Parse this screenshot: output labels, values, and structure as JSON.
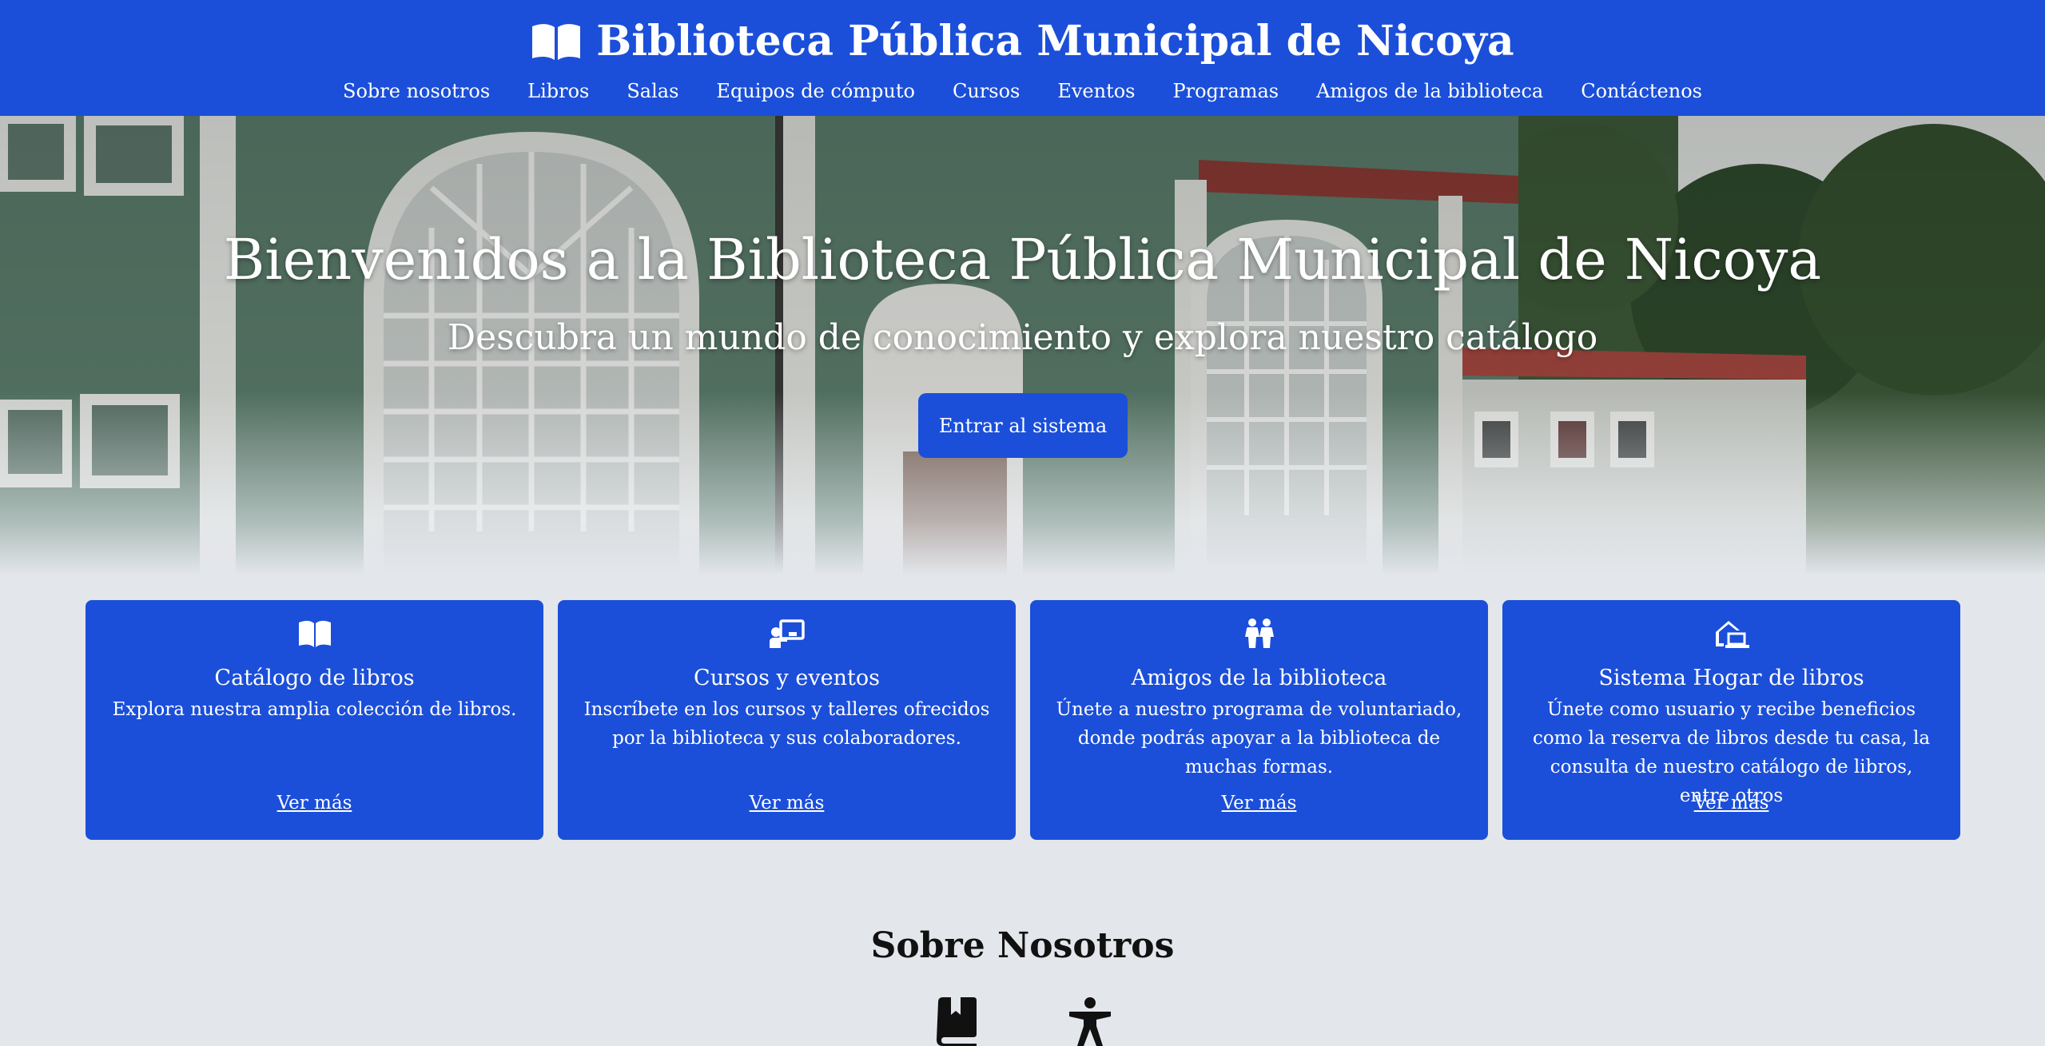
{
  "header": {
    "title": "Biblioteca Pública Municipal de Nicoya",
    "brand_icon": "open-book-icon",
    "nav": [
      "Sobre nosotros",
      "Libros",
      "Salas",
      "Equipos de cómputo",
      "Cursos",
      "Eventos",
      "Programas",
      "Amigos de la biblioteca",
      "Contáctenos"
    ]
  },
  "hero": {
    "title": "Bienvenidos a la Biblioteca Pública Municipal de Nicoya",
    "subtitle": "Descubra un mundo de conocimiento y explora nuestro catálogo",
    "button": "Entrar al sistema"
  },
  "cards": [
    {
      "icon": "open-book-icon",
      "title": "Catálogo de libros",
      "description": "Explora nuestra amplia colección de libros.",
      "link": "Ver más"
    },
    {
      "icon": "presentation-icon",
      "title": "Cursos y eventos",
      "description": "Inscríbete en los cursos y talleres ofrecidos por la biblioteca y sus colaboradores.",
      "link": "Ver más"
    },
    {
      "icon": "people-icon",
      "title": "Amigos de la biblioteca",
      "description": "Únete a nuestro programa de voluntariado, donde podrás apoyar a la biblioteca de muchas formas.",
      "link": "Ver más"
    },
    {
      "icon": "home-laptop-icon",
      "title": "Sistema Hogar de libros",
      "description": "Únete como usuario y recibe beneficios como la reserva de libros desde tu casa, la consulta de nuestro catálogo de libros, entre otros",
      "link": "Ver más"
    }
  ],
  "about": {
    "title": "Sobre Nosotros",
    "icons": [
      "book-bookmark-icon",
      "accessibility-icon"
    ]
  },
  "colors": {
    "primary": "#1b4fd9",
    "background": "#e3e6eb",
    "text_dark": "#111111"
  }
}
